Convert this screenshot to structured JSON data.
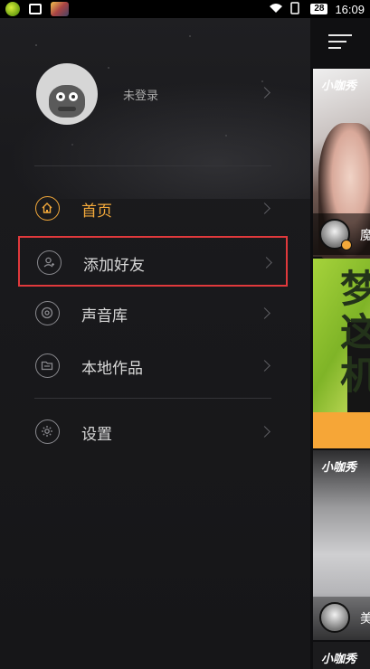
{
  "status_bar": {
    "battery": "28",
    "time": "16:09"
  },
  "drawer": {
    "profile": {
      "login_text": "未登录"
    },
    "menu": [
      {
        "label": "首页",
        "icon": "home-icon",
        "active": true
      },
      {
        "label": "添加好友",
        "icon": "add-friend-icon",
        "active": false
      },
      {
        "label": "声音库",
        "icon": "sound-library-icon",
        "active": false
      },
      {
        "label": "本地作品",
        "icon": "folder-icon",
        "active": false
      }
    ],
    "settings": {
      "label": "设置",
      "icon": "gear-icon"
    }
  },
  "feed": {
    "brand": "小咖秀",
    "card1_caption": "魔",
    "card2_text": "梦\n这\n机",
    "card3_caption": "美"
  },
  "colors": {
    "accent": "#f3a93a",
    "highlight_box": "#e0393c",
    "drawer_bg": "#1a1a1d"
  }
}
